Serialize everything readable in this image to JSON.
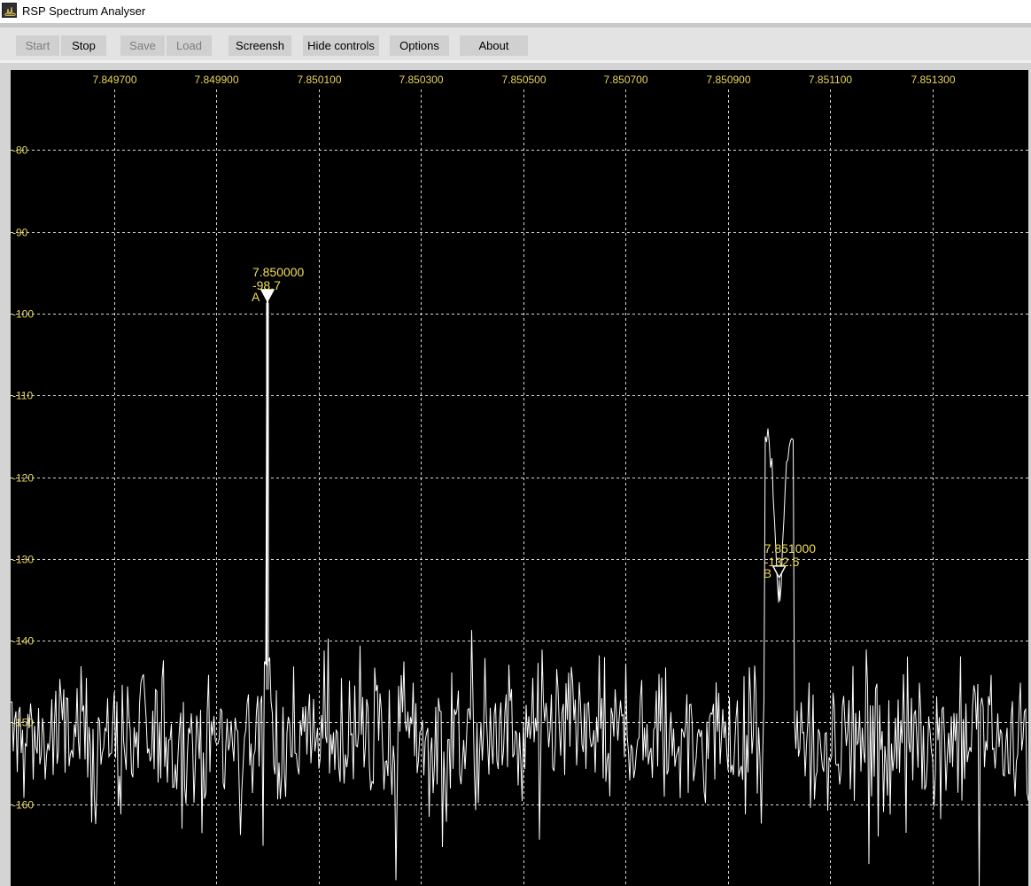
{
  "window": {
    "title": "RSP Spectrum Analyser",
    "icon": "spectrum-app-icon"
  },
  "toolbar": {
    "buttons": [
      {
        "label": "Start",
        "enabled": false
      },
      {
        "label": "Stop",
        "enabled": true
      },
      {
        "label": "Save",
        "enabled": false
      },
      {
        "label": "Load",
        "enabled": false
      },
      {
        "label": "Screensh",
        "enabled": true
      },
      {
        "label": "Hide controls",
        "enabled": true
      },
      {
        "label": "Options",
        "enabled": true
      },
      {
        "label": "About",
        "enabled": true
      }
    ]
  },
  "colors": {
    "background": "#000000",
    "grid": "#d8d8d8",
    "trace": "#ffffff",
    "labels": "#e8d65a"
  },
  "chart_data": {
    "type": "line",
    "x_tick_labels": [
      "7.849700",
      "7.849900",
      "7.850100",
      "7.850300",
      "7.850500",
      "7.850700",
      "7.850900",
      "7.851100",
      "7.851300"
    ],
    "y_tick_labels": [
      "-80",
      "-90",
      "-100",
      "-110",
      "-120",
      "-130",
      "-140",
      "-150",
      "-160"
    ],
    "x_ticks": [
      7.8497,
      7.8499,
      7.8501,
      7.8503,
      7.8505,
      7.8507,
      7.8509,
      7.8511,
      7.8513
    ],
    "y_ticks": [
      -80,
      -90,
      -100,
      -110,
      -120,
      -130,
      -140,
      -150,
      -160
    ],
    "xlim": [
      7.8494981,
      7.8514869
    ],
    "ylim": [
      -170,
      -70.2
    ],
    "grid": true,
    "noise_floor": -152,
    "noise_spread": 4.5,
    "markers": [
      {
        "label": "A",
        "freq_text": "7.850000",
        "level_text": "-98.7",
        "freq": 7.85,
        "level": -98.7
      },
      {
        "label": "B",
        "freq_text": "7.851000",
        "level_text": "-132.5",
        "freq": 7.851,
        "level": -132.5
      }
    ]
  }
}
